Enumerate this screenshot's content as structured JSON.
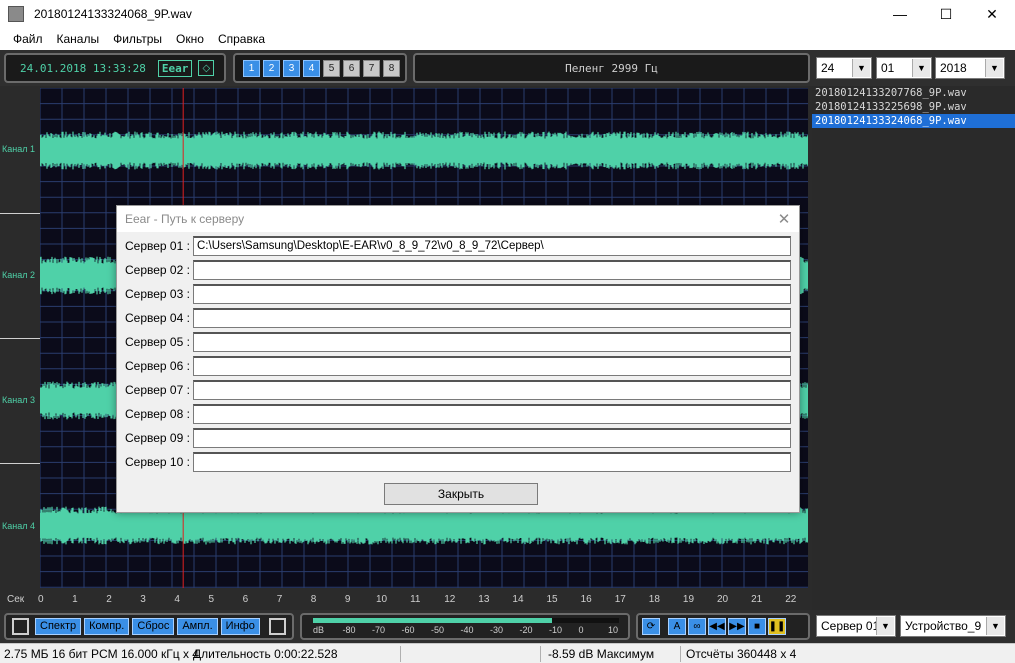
{
  "window": {
    "title": "20180124133324068_9P.wav",
    "minimize": "—",
    "maximize": "☐",
    "close": "✕"
  },
  "menu": [
    "Файл",
    "Каналы",
    "Фильтры",
    "Окно",
    "Справка"
  ],
  "toolbar": {
    "datetime": "24.01.2018 13:33:28",
    "eear_label": "Eear",
    "channel_buttons": [
      {
        "label": "1",
        "active": true
      },
      {
        "label": "2",
        "active": true
      },
      {
        "label": "3",
        "active": true
      },
      {
        "label": "4",
        "active": true
      },
      {
        "label": "5",
        "active": false
      },
      {
        "label": "6",
        "active": false
      },
      {
        "label": "7",
        "active": false
      },
      {
        "label": "8",
        "active": false
      }
    ],
    "bearing": "Пеленг 2999 Гц",
    "day": "24",
    "month": "01",
    "year": "2018"
  },
  "files": [
    {
      "name": "20180124133207768_9P.wav",
      "selected": false
    },
    {
      "name": "20180124133225698_9P.wav",
      "selected": false
    },
    {
      "name": "20180124133324068_9P.wav",
      "selected": true
    }
  ],
  "channels": [
    "Канал 1",
    "Канал 2",
    "Канал 3",
    "Канал 4"
  ],
  "waveform_color": "#4fd1a8",
  "ruler": {
    "label": "Сек",
    "ticks": [
      "0",
      "1",
      "2",
      "3",
      "4",
      "5",
      "6",
      "7",
      "8",
      "9",
      "10",
      "11",
      "12",
      "13",
      "14",
      "15",
      "16",
      "17",
      "18",
      "19",
      "20",
      "21",
      "22"
    ]
  },
  "cursor_seconds": 4.2,
  "bottom": {
    "buttons": [
      "Спектр",
      "Компр.",
      "Сброс",
      "Ампл.",
      "Инфо"
    ],
    "meter_labels": [
      "dB",
      "-80",
      "-70",
      "-60",
      "-50",
      "-40",
      "-30",
      "-20",
      "-10",
      "0",
      "10"
    ],
    "meter_level_fraction": 0.78,
    "server_select": "Сервер 01",
    "device_select": "Устройство_9"
  },
  "status": {
    "format": "2.75 МБ 16 бит PCM 16.000 кГц x 4",
    "duration": "Длительность 0:00:22.528",
    "max": "-8.59 dB Максимум",
    "samples": "Отсчёты 360448 x 4"
  },
  "dialog": {
    "title": "Eear - Путь к серверу",
    "close": "✕",
    "rows": [
      {
        "label": "Сервер 01 :",
        "value": "C:\\Users\\Samsung\\Desktop\\E-EAR\\v0_8_9_72\\v0_8_9_72\\Сервер\\"
      },
      {
        "label": "Сервер 02 :",
        "value": ""
      },
      {
        "label": "Сервер 03 :",
        "value": ""
      },
      {
        "label": "Сервер 04 :",
        "value": ""
      },
      {
        "label": "Сервер 05 :",
        "value": ""
      },
      {
        "label": "Сервер 06 :",
        "value": ""
      },
      {
        "label": "Сервер 07 :",
        "value": ""
      },
      {
        "label": "Сервер 08 :",
        "value": ""
      },
      {
        "label": "Сервер 09 :",
        "value": ""
      },
      {
        "label": "Сервер 10 :",
        "value": ""
      }
    ],
    "close_button": "Закрыть"
  }
}
